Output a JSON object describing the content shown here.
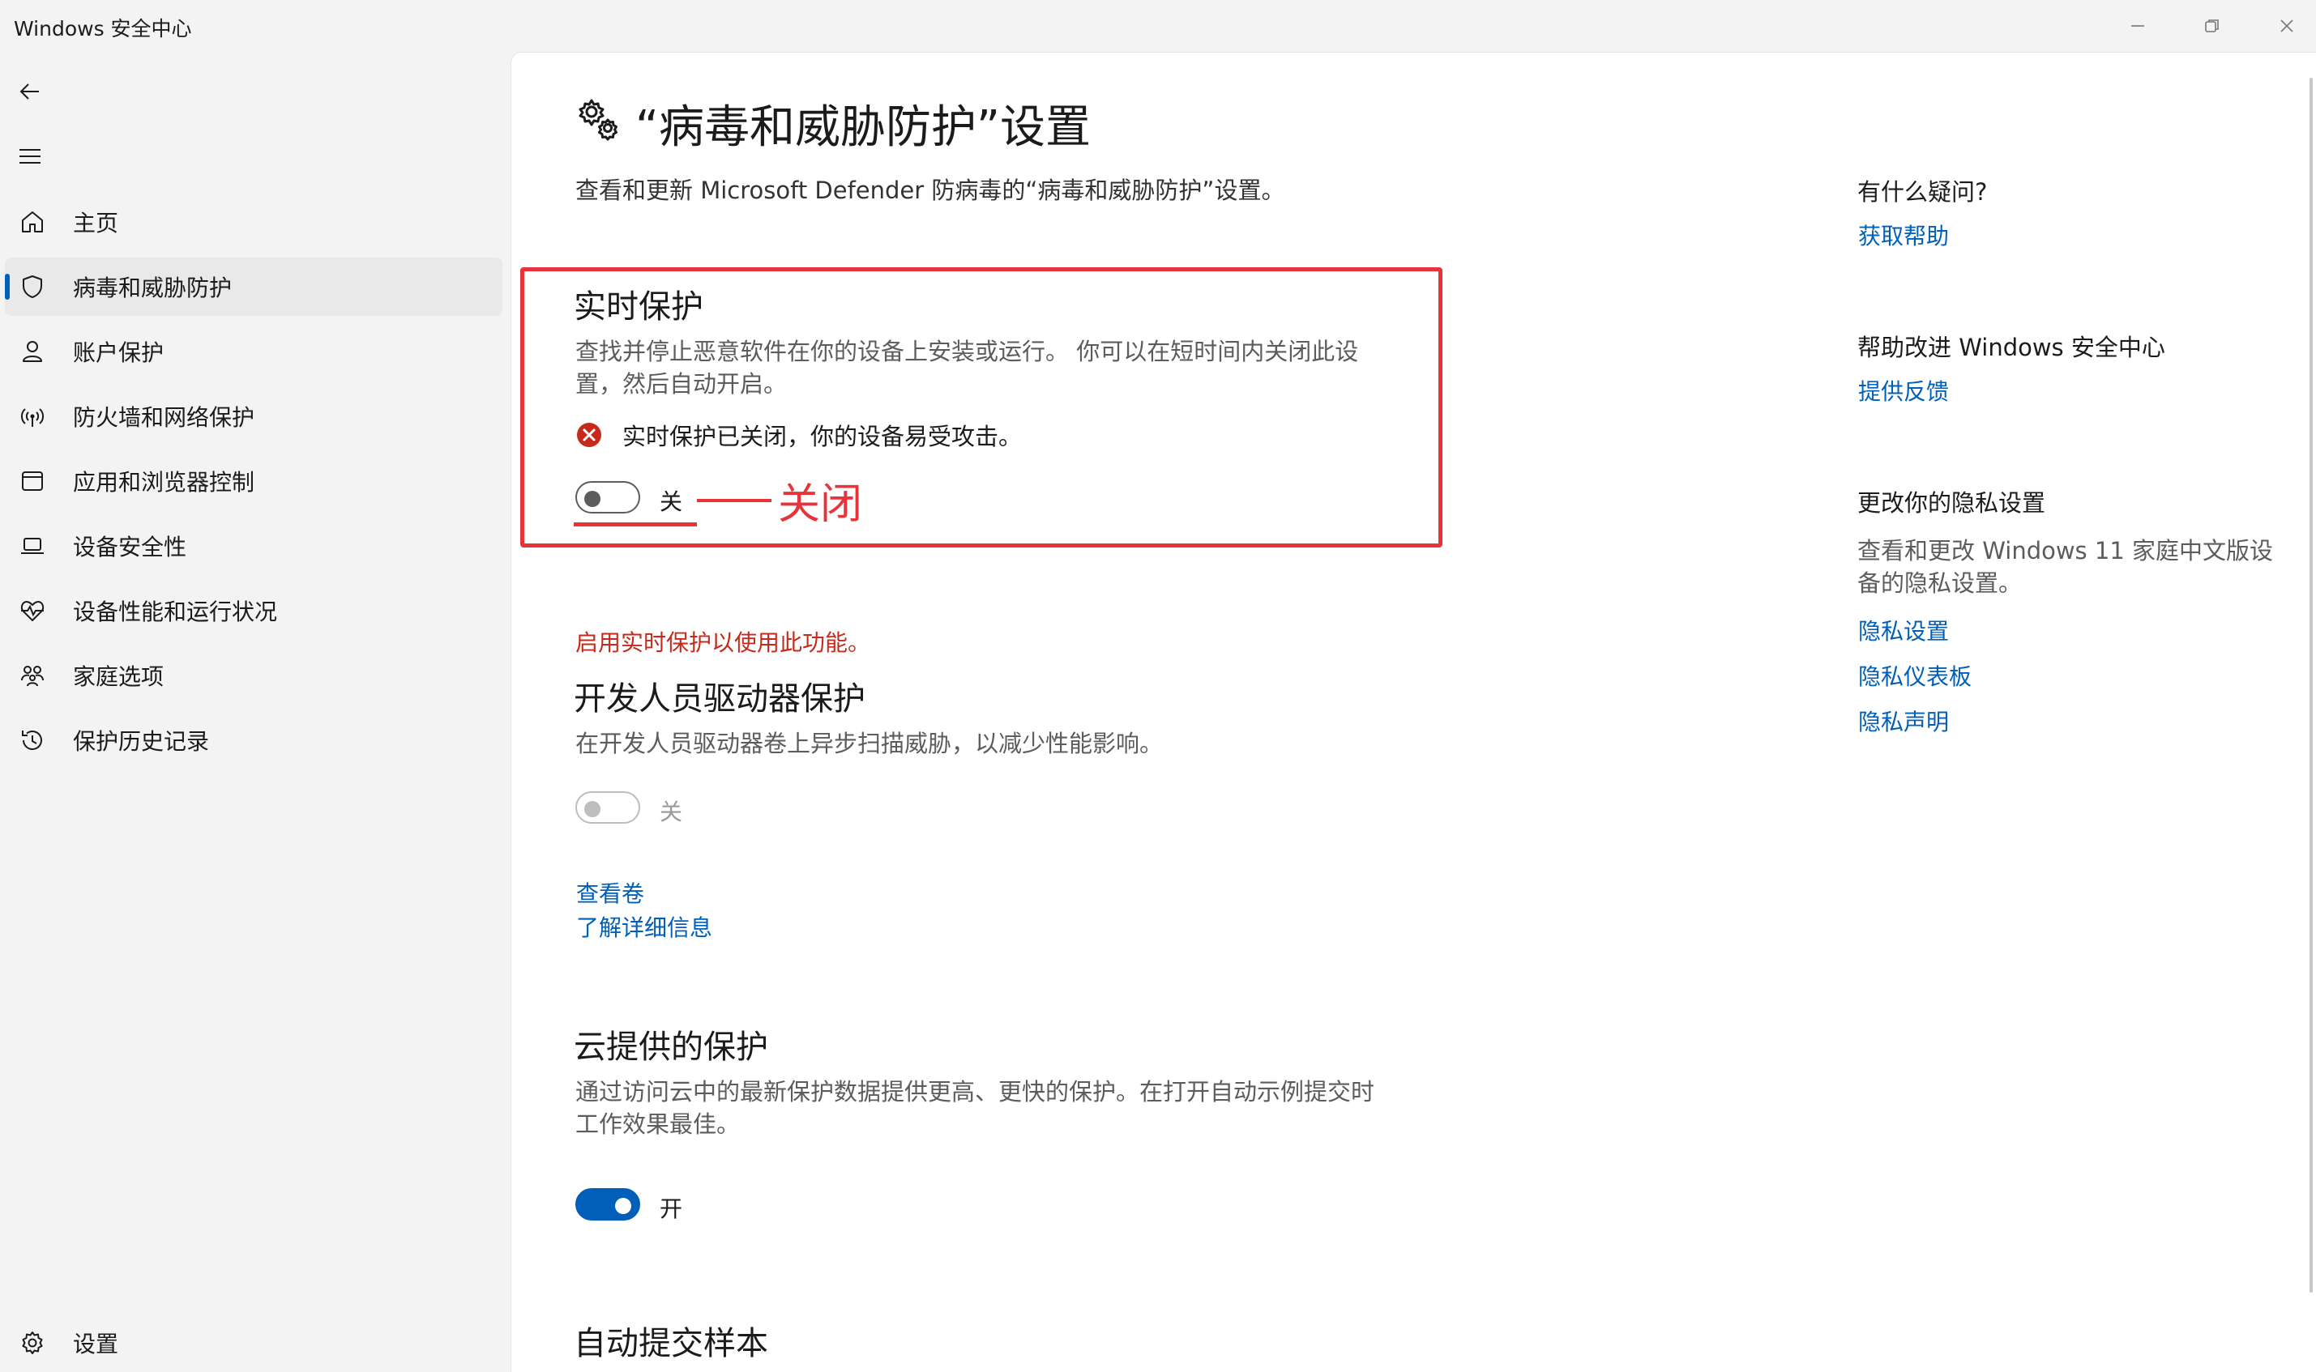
{
  "window": {
    "title": "Windows 安全中心",
    "controls": [
      "minimize-icon",
      "restore-icon",
      "close-icon"
    ]
  },
  "sidebar": {
    "back_icon": "back-arrow-icon",
    "menu_icon": "hamburger-menu-icon",
    "items": [
      {
        "label": "主页",
        "icon": "home-icon",
        "active": false
      },
      {
        "label": "病毒和威胁防护",
        "icon": "shield-icon",
        "active": true
      },
      {
        "label": "账户保护",
        "icon": "person-icon",
        "active": false
      },
      {
        "label": "防火墙和网络保护",
        "icon": "wireless-signal-icon",
        "active": false
      },
      {
        "label": "应用和浏览器控制",
        "icon": "browser-window-icon",
        "active": false
      },
      {
        "label": "设备安全性",
        "icon": "laptop-icon",
        "active": false
      },
      {
        "label": "设备性能和运行状况",
        "icon": "heart-pulse-icon",
        "active": false
      },
      {
        "label": "家庭选项",
        "icon": "family-icon",
        "active": false
      },
      {
        "label": "保护历史记录",
        "icon": "history-icon",
        "active": false
      }
    ],
    "settings": {
      "label": "设置",
      "icon": "gear-icon"
    }
  },
  "page": {
    "icon": "gears-icon",
    "title": "“病毒和威胁防护”设置",
    "subtitle": "查看和更新 Microsoft Defender 防病毒的“病毒和威胁防护”设置。"
  },
  "realtime": {
    "title": "实时保护",
    "description": "查找并停止恶意软件在你的设备上安装或运行。 你可以在短时间内关闭此设置，然后自动开启。",
    "alert_icon": "error-x-circle-icon",
    "alert": "实时保护已关闭，你的设备易受攻击。",
    "toggle_state": "off",
    "toggle_label": "关"
  },
  "annotation": {
    "label": "关闭",
    "color": "#e8333b"
  },
  "dev_drive": {
    "warning": "启用实时保护以使用此功能。",
    "title": "开发人员驱动器保护",
    "description": "在开发人员驱动器卷上异步扫描威胁，以减少性能影响。",
    "toggle_state": "off-disabled",
    "toggle_label": "关",
    "links": [
      "查看卷",
      "了解详细信息"
    ]
  },
  "cloud": {
    "title": "云提供的保护",
    "description": "通过访问云中的最新保护数据提供更高、更快的保护。在打开自动示例提交时工作效果最佳。",
    "toggle_state": "on",
    "toggle_label": "开"
  },
  "auto_submit": {
    "title": "自动提交样本"
  },
  "right_rail": {
    "questions": {
      "heading": "有什么疑问?",
      "link": "获取帮助"
    },
    "feedback": {
      "heading": "帮助改进 Windows 安全中心",
      "link": "提供反馈"
    },
    "privacy": {
      "heading": "更改你的隐私设置",
      "description": "查看和更改 Windows 11 家庭中文版设备的隐私设置。",
      "links": [
        "隐私设置",
        "隐私仪表板",
        "隐私声明"
      ]
    }
  },
  "colors": {
    "accent": "#005fb8",
    "error": "#c42b1c",
    "annotation": "#e8333b"
  }
}
